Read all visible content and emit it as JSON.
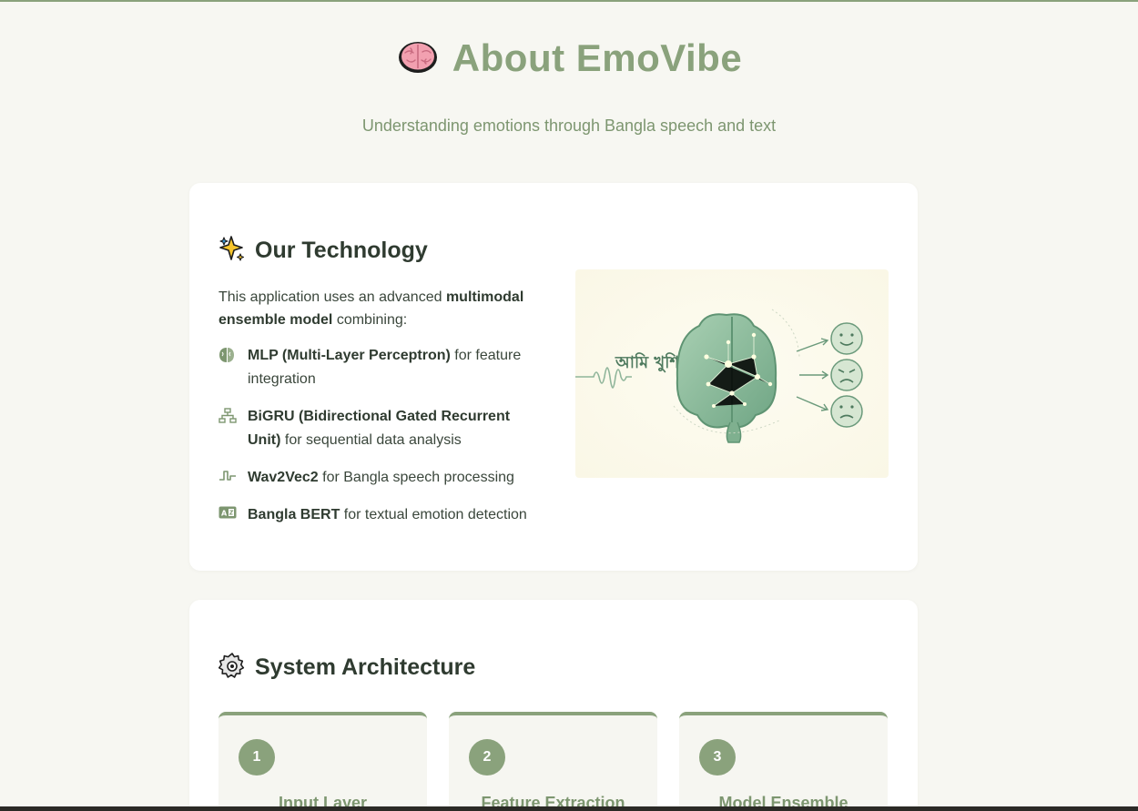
{
  "hero": {
    "title": "About EmoVibe",
    "subtitle": "Understanding emotions through Bangla speech and text"
  },
  "technology": {
    "heading": "Our Technology",
    "intro_pre": "This application uses an advanced ",
    "intro_bold": "multimodal ensemble model",
    "intro_post": " combining:",
    "items": [
      {
        "icon": "brain-half-icon",
        "bold": "MLP (Multi-Layer Perceptron)",
        "rest": " for feature integration"
      },
      {
        "icon": "network-diagram-icon",
        "bold": "BiGRU (Bidirectional Gated Recurrent Unit)",
        "rest": " for sequential data analysis"
      },
      {
        "icon": "square-wave-icon",
        "bold": "Wav2Vec2",
        "rest": " for Bangla speech processing"
      },
      {
        "icon": "translate-card-icon",
        "bold": "Bangla BERT",
        "rest": " for textual emotion detection"
      }
    ],
    "illustration_text": "আমি খুশি"
  },
  "architecture": {
    "heading": "System Architecture",
    "steps": [
      {
        "number": "1",
        "title": "Input Layer"
      },
      {
        "number": "2",
        "title": "Feature Extraction"
      },
      {
        "number": "3",
        "title": "Model Ensemble"
      }
    ]
  },
  "colors": {
    "accent": "#8aa27c",
    "background": "#f7f7f2",
    "card": "#ffffff",
    "text": "#2f3b30"
  }
}
